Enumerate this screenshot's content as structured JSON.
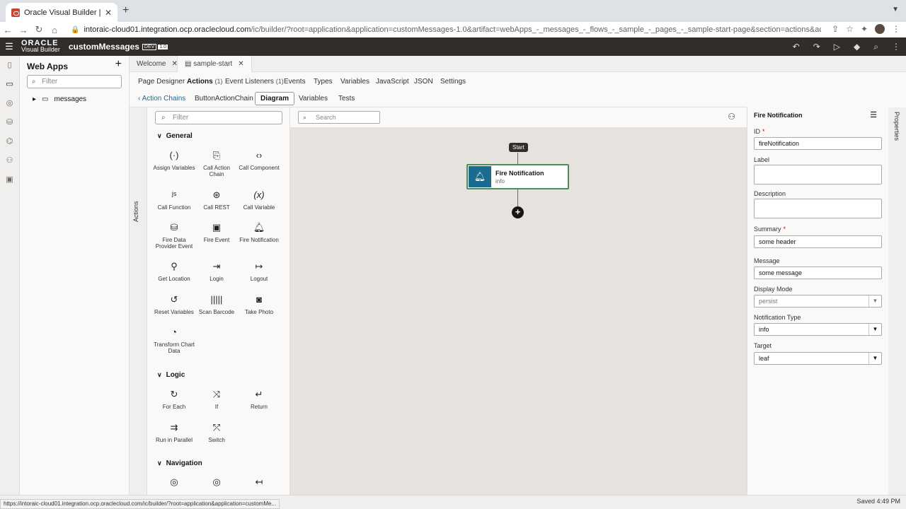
{
  "browser": {
    "tab_title": "Oracle Visual Builder | custom",
    "tab_close": "✕",
    "new_tab": "+",
    "url_host": "intoraic-cloud01.integration.ocp.oraclecloud.com",
    "url_path": "/ic/builder/?root=application&application=customMessages-1.0&artifact=webApps_-_messages_-_flows_-_sample_-_pages_-_sample-start-page&section=actions&actionChain=ButtonAc..."
  },
  "app": {
    "logo_top": "ORACLE",
    "logo_bottom": "Visual Builder",
    "name": "customMessages",
    "badge_env": "DEV",
    "badge_ver": "1.0"
  },
  "navigator": {
    "title": "Web Apps",
    "filter_placeholder": "Filter",
    "item": "messages"
  },
  "editor_tabs": [
    {
      "label": "Welcome"
    },
    {
      "label": "sample-start"
    }
  ],
  "designer_tabs": [
    {
      "label": "Page Designer"
    },
    {
      "label": "Actions",
      "count": "(1)"
    },
    {
      "label": "Event Listeners",
      "count": "(1)"
    },
    {
      "label": "Events"
    },
    {
      "label": "Types"
    },
    {
      "label": "Variables"
    },
    {
      "label": "JavaScript"
    },
    {
      "label": "JSON"
    },
    {
      "label": "Settings"
    }
  ],
  "chain_bar": {
    "back": "Action Chains",
    "chain_name": "ButtonActionChain",
    "diagram": "Diagram",
    "variables": "Variables",
    "tests": "Tests"
  },
  "palette": {
    "side_label": "Actions",
    "filter_placeholder": "Filter",
    "sections": [
      {
        "title": "General"
      },
      {
        "title": "Logic"
      },
      {
        "title": "Navigation"
      }
    ],
    "general": [
      "Assign Variables",
      "Call Action Chain",
      "Call Component",
      "Call Function",
      "Call REST",
      "Call Variable",
      "Fire Data Provider Event",
      "Fire Event",
      "Fire Notification",
      "Get Location",
      "Login",
      "Logout",
      "Reset Variables",
      "Scan Barcode",
      "Take Photo",
      "Transform Chart Data"
    ],
    "logic": [
      "For Each",
      "If",
      "Return",
      "Run in Parallel",
      "Switch"
    ]
  },
  "canvas": {
    "search_placeholder": "Search",
    "start": "Start",
    "node_title": "Fire Notification",
    "node_sub": "info"
  },
  "properties": {
    "title": "Fire Notification",
    "side_label": "Properties",
    "id_label": "ID",
    "id_value": "fireNotification",
    "label_label": "Label",
    "description_label": "Description",
    "summary_label": "Summary",
    "summary_value": "some header",
    "message_label": "Message",
    "message_value": "some message",
    "display_mode_label": "Display Mode",
    "display_mode_value": "persist",
    "notification_type_label": "Notification Type",
    "notification_type_value": "info",
    "target_label": "Target",
    "target_value": "leaf"
  },
  "status": {
    "hover_url": "https://intoraic-cloud01.integration.ocp.oraclecloud.com/ic/builder/?root=application&application=customMe...",
    "saved": "Saved 4:49 PM"
  },
  "colors": {
    "header_bg": "#312d2a",
    "node_icon_bg": "#1b6b8f",
    "node_border": "#4a8f5a",
    "canvas_bg": "#e6e2dd"
  }
}
